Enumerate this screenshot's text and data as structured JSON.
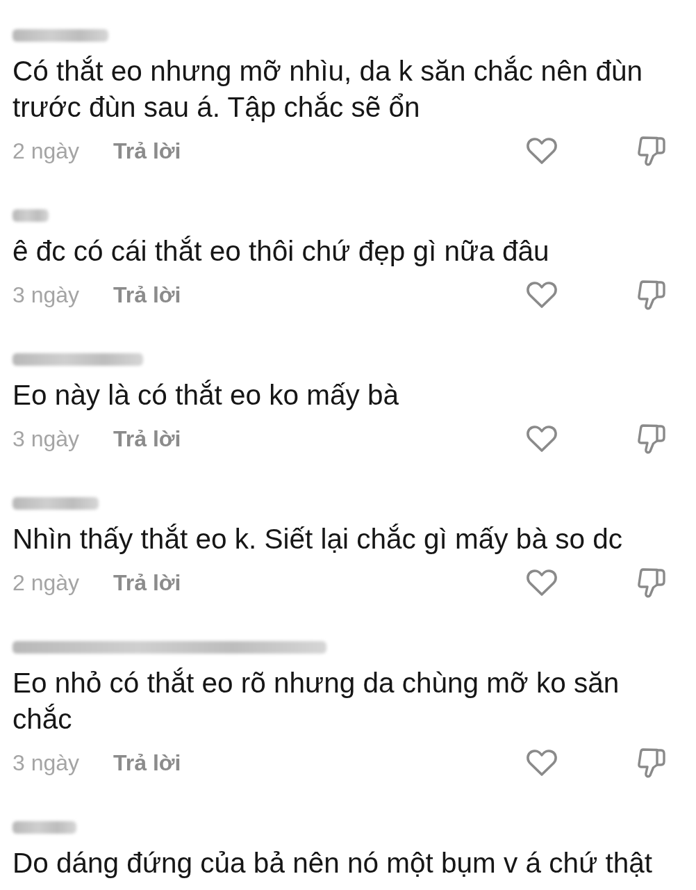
{
  "comments": [
    {
      "text": "Có thắt eo nhưng mỡ nhìu, da k săn chắc nên đùn trước đùn sau á. Tập chắc sẽ ổn",
      "age": "2 ngày",
      "reply": "Trả lời",
      "liked": false,
      "disliked": false
    },
    {
      "text": "ê đc có cái thắt eo thôi chứ đẹp gì nữa đâu",
      "age": "3 ngày",
      "reply": "Trả lời",
      "liked": false,
      "disliked": false
    },
    {
      "text": "Eo này là có thắt eo ko mấy bà",
      "age": "3 ngày",
      "reply": "Trả lời",
      "liked": false,
      "disliked": false
    },
    {
      "text": "Nhìn thấy thắt eo k. Siết lại chắc gì mấy bà so dc",
      "age": "2 ngày",
      "reply": "Trả lời",
      "liked": false,
      "disliked": false
    },
    {
      "text": "Eo nhỏ có thắt eo rõ nhưng da chùng mỡ ko săn chắc",
      "age": "3 ngày",
      "reply": "Trả lời",
      "liked": false,
      "disliked": false
    },
    {
      "text": "Do dáng đứng của bả nên nó một bụm v á chứ thật"
    }
  ]
}
